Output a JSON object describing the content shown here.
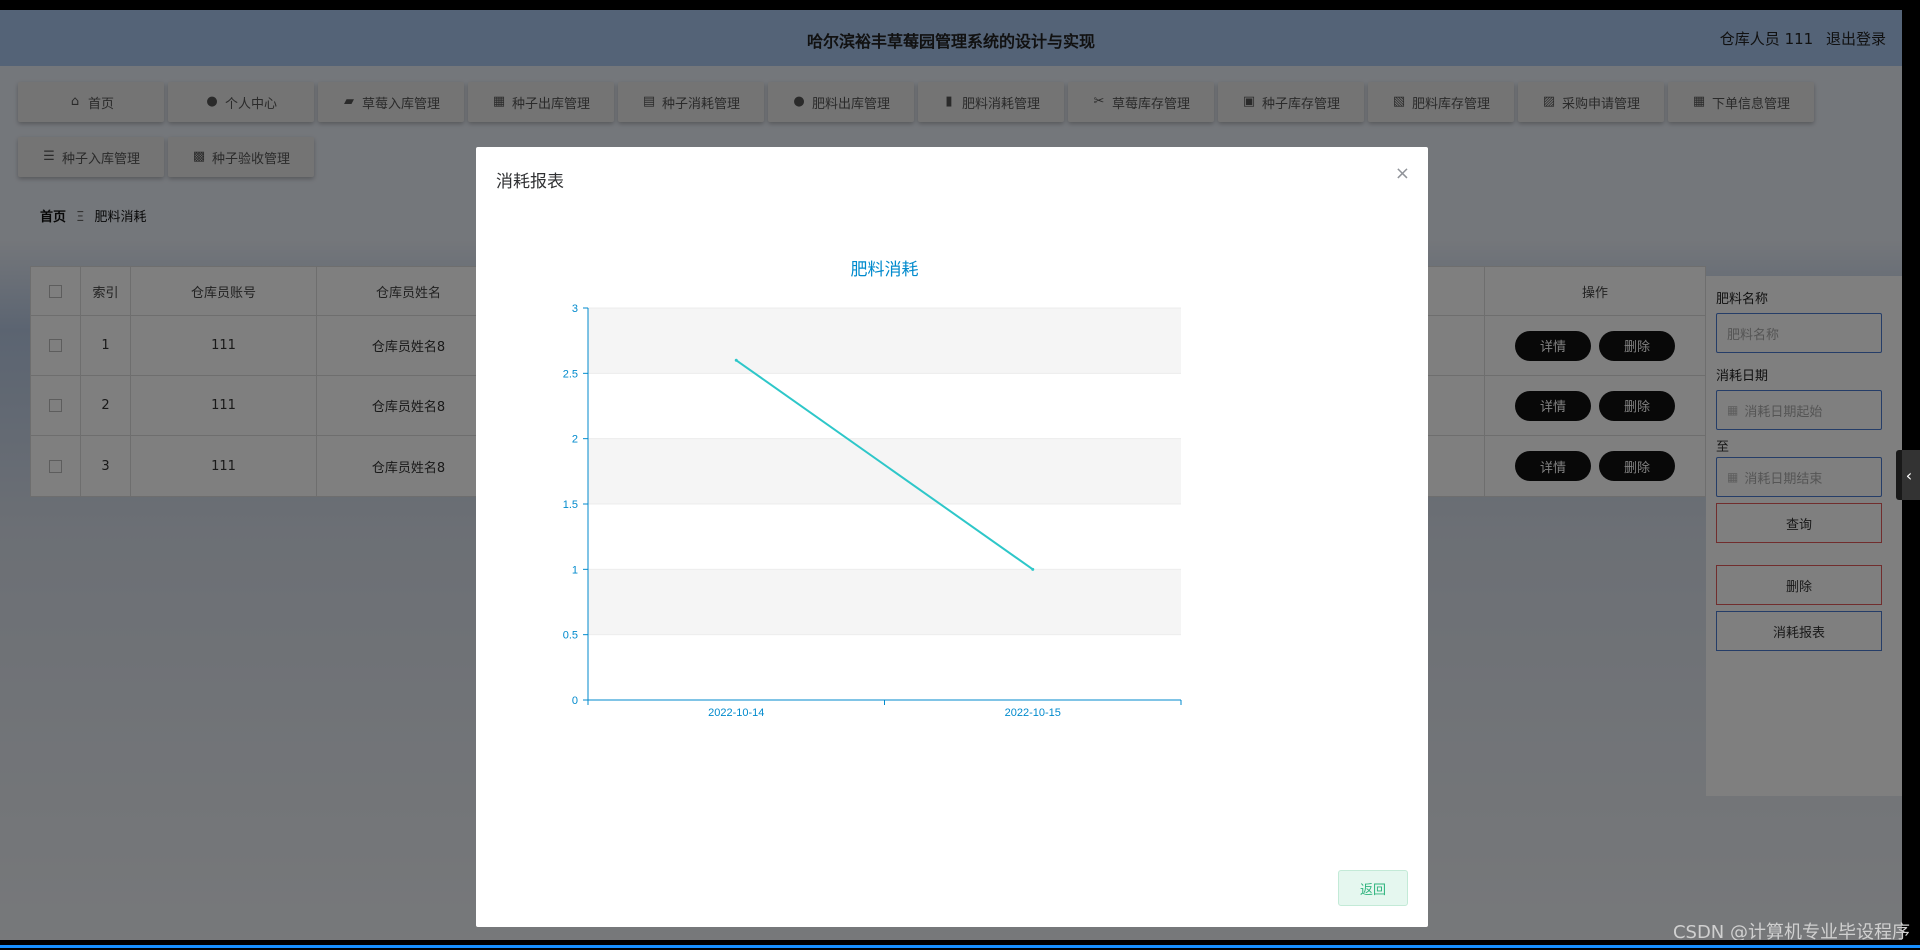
{
  "header": {
    "title": "哈尔滨裕丰草莓园管理系统的设计与实现",
    "user_label": "仓库人员 111",
    "logout": "退出登录"
  },
  "nav": {
    "row1": [
      {
        "label": "首页",
        "icon": "home-icon"
      },
      {
        "label": "个人中心",
        "icon": "user-icon"
      },
      {
        "label": "草莓入库管理",
        "icon": "truck-icon"
      },
      {
        "label": "种子出库管理",
        "icon": "grid-icon"
      },
      {
        "label": "种子消耗管理",
        "icon": "clipboard-icon"
      },
      {
        "label": "肥料出库管理",
        "icon": "user-icon"
      },
      {
        "label": "肥料消耗管理",
        "icon": "bar-chart-icon"
      },
      {
        "label": "草莓库存管理",
        "icon": "ticket-icon"
      },
      {
        "label": "种子库存管理",
        "icon": "printer-icon"
      },
      {
        "label": "肥料库存管理",
        "icon": "clipboard-check-icon"
      },
      {
        "label": "采购申请管理",
        "icon": "chart-box-icon"
      },
      {
        "label": "下单信息管理",
        "icon": "grid-icon"
      }
    ],
    "row2": [
      {
        "label": "种子入库管理",
        "icon": "sliders-icon"
      },
      {
        "label": "种子验收管理",
        "icon": "clipboard-x-icon"
      }
    ]
  },
  "breadcrumb": {
    "home": "首页",
    "sep": "Ξ",
    "current": "肥料消耗"
  },
  "table": {
    "headers": {
      "index": "索引",
      "account": "仓库员账号",
      "name": "仓库员姓名",
      "ops": "操作"
    },
    "rows": [
      {
        "index": "1",
        "account": "111",
        "name": "仓库员姓名8"
      },
      {
        "index": "2",
        "account": "111",
        "name": "仓库员姓名8"
      },
      {
        "index": "3",
        "account": "111",
        "name": "仓库员姓名8"
      }
    ],
    "detail_label": "详情",
    "delete_label": "删除"
  },
  "search": {
    "fert_label": "肥料名称",
    "fert_placeholder": "肥料名称",
    "date_label": "消耗日期",
    "date_start": "消耗日期起始",
    "to": "至",
    "date_end": "消耗日期结束",
    "query": "查询",
    "delete": "删除",
    "report": "消耗报表"
  },
  "dialog": {
    "title": "消耗报表",
    "close": "×",
    "return": "返回"
  },
  "chart_data": {
    "type": "line",
    "title": "肥料消耗",
    "categories": [
      "2022-10-14",
      "2022-10-15"
    ],
    "series": [
      {
        "values": [
          2.6,
          1
        ]
      }
    ],
    "ylim": [
      0,
      3
    ],
    "yticks": [
      "0",
      "0.5",
      "1",
      "1.5",
      "2",
      "2.5",
      "3"
    ],
    "grid": true,
    "colors": {
      "line": "#2ec7c9",
      "axis": "#008acd",
      "title": "#008acd"
    }
  },
  "watermark": "CSDN @计算机专业毕设程序"
}
